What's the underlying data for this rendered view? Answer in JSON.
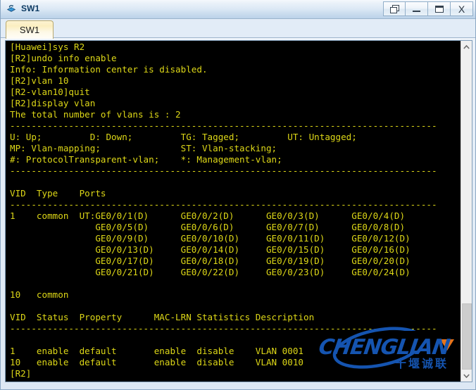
{
  "window": {
    "title": "SW1",
    "app_icon": "switch-device-icon",
    "controls": [
      {
        "name": "restore-button",
        "icon": "restore-windows-icon",
        "label": ""
      },
      {
        "name": "minimize-button",
        "icon": "minimize-icon",
        "label": ""
      },
      {
        "name": "maximize-button",
        "icon": "maximize-icon",
        "label": ""
      },
      {
        "name": "close-button",
        "icon": "close-icon",
        "label": "X"
      }
    ]
  },
  "tabs": [
    {
      "label": "SW1",
      "active": true
    }
  ],
  "terminal": {
    "foreground_color": "#ddd717",
    "background_color": "#000000",
    "prompt": "[R2]",
    "lines": [
      "[Huawei]sys R2",
      "[R2]undo info enable",
      "Info: Information center is disabled.",
      "[R2]vlan 10",
      "[R2-vlan10]quit",
      "[R2]display vlan",
      "The total number of vlans is : 2",
      "--------------------------------------------------------------------------------",
      "U: Up;         D: Down;         TG: Tagged;         UT: Untagged;",
      "MP: Vlan-mapping;               ST: Vlan-stacking;",
      "#: ProtocolTransparent-vlan;    *: Management-vlan;",
      "--------------------------------------------------------------------------------",
      "",
      "VID  Type    Ports",
      "--------------------------------------------------------------------------------",
      "1    common  UT:GE0/0/1(D)      GE0/0/2(D)      GE0/0/3(D)      GE0/0/4(D)",
      "                GE0/0/5(D)      GE0/0/6(D)      GE0/0/7(D)      GE0/0/8(D)",
      "                GE0/0/9(D)      GE0/0/10(D)     GE0/0/11(D)     GE0/0/12(D)",
      "                GE0/0/13(D)     GE0/0/14(D)     GE0/0/15(D)     GE0/0/16(D)",
      "                GE0/0/17(D)     GE0/0/18(D)     GE0/0/19(D)     GE0/0/20(D)",
      "                GE0/0/21(D)     GE0/0/22(D)     GE0/0/23(D)     GE0/0/24(D)",
      "",
      "10   common",
      "",
      "VID  Status  Property      MAC-LRN Statistics Description",
      "--------------------------------------------------------------------------------",
      "",
      "1    enable  default       enable  disable    VLAN 0001",
      "10   enable  default       enable  disable    VLAN 0010",
      "[R2]"
    ],
    "legend": {
      "U": "Up",
      "D": "Down",
      "TG": "Tagged",
      "UT": "Untagged",
      "MP": "Vlan-mapping",
      "ST": "Vlan-stacking",
      "#": "ProtocolTransparent-vlan",
      "*": "Management-vlan"
    },
    "vlan_summary": {
      "total_vlans": 2
    },
    "ports_table": {
      "headers": [
        "VID",
        "Type",
        "Ports"
      ],
      "rows": [
        {
          "vid": "1",
          "type": "common",
          "tag_mode": "UT",
          "ports": [
            "GE0/0/1(D)",
            "GE0/0/2(D)",
            "GE0/0/3(D)",
            "GE0/0/4(D)",
            "GE0/0/5(D)",
            "GE0/0/6(D)",
            "GE0/0/7(D)",
            "GE0/0/8(D)",
            "GE0/0/9(D)",
            "GE0/0/10(D)",
            "GE0/0/11(D)",
            "GE0/0/12(D)",
            "GE0/0/13(D)",
            "GE0/0/14(D)",
            "GE0/0/15(D)",
            "GE0/0/16(D)",
            "GE0/0/17(D)",
            "GE0/0/18(D)",
            "GE0/0/19(D)",
            "GE0/0/20(D)",
            "GE0/0/21(D)",
            "GE0/0/22(D)",
            "GE0/0/23(D)",
            "GE0/0/24(D)"
          ]
        },
        {
          "vid": "10",
          "type": "common",
          "tag_mode": "",
          "ports": []
        }
      ]
    },
    "status_table": {
      "headers": [
        "VID",
        "Status",
        "Property",
        "MAC-LRN",
        "Statistics",
        "Description"
      ],
      "rows": [
        [
          "1",
          "enable",
          "default",
          "enable",
          "disable",
          "VLAN 0001"
        ],
        [
          "10",
          "enable",
          "default",
          "enable",
          "disable",
          "VLAN 0010"
        ]
      ]
    }
  },
  "watermark": {
    "brand": "CHENGLIAN",
    "subtitle": "十堰诚联",
    "brand_color": "#1554b0",
    "accent_color": "#e8741a"
  },
  "scrollbar": {
    "up_arrow": "chevron-up-icon",
    "down_arrow": "chevron-down-icon",
    "thumb_position": "near-bottom"
  }
}
